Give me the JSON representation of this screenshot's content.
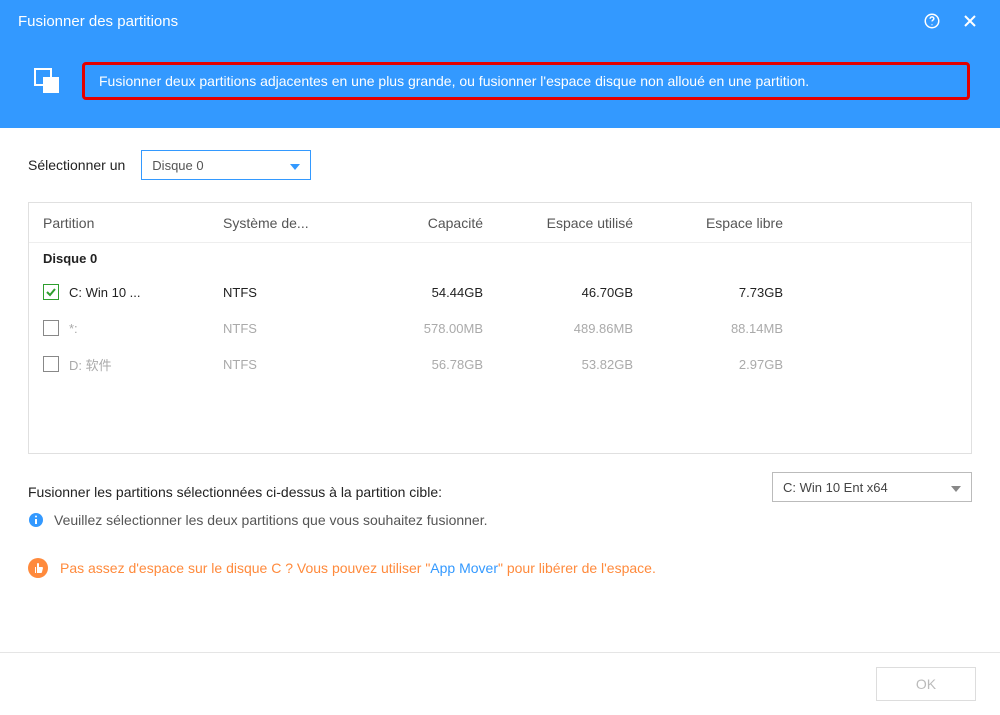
{
  "titlebar": {
    "title": "Fusionner des partitions"
  },
  "banner": {
    "text": "Fusionner deux partitions adjacentes en une plus grande, ou fusionner l'espace disque non alloué en une partition."
  },
  "selector": {
    "label": "Sélectionner un",
    "value": "Disque 0"
  },
  "table": {
    "headers": {
      "partition": "Partition",
      "fs": "Système de...",
      "capacity": "Capacité",
      "used": "Espace utilisé",
      "free": "Espace libre"
    },
    "group": "Disque 0",
    "rows": [
      {
        "checked": true,
        "enabled": true,
        "name": "C: Win 10 ...",
        "fs": "NTFS",
        "capacity": "54.44GB",
        "used": "46.70GB",
        "free": "7.73GB"
      },
      {
        "checked": false,
        "enabled": false,
        "name": "*:",
        "fs": "NTFS",
        "capacity": "578.00MB",
        "used": "489.86MB",
        "free": "88.14MB"
      },
      {
        "checked": false,
        "enabled": false,
        "name": "D: 软件",
        "fs": "NTFS",
        "capacity": "56.78GB",
        "used": "53.82GB",
        "free": "2.97GB"
      }
    ]
  },
  "below": {
    "label": "Fusionner les partitions sélectionnées ci-dessus à la partition cible:",
    "target_value": "C: Win 10 Ent x64"
  },
  "info": {
    "text": "Veuillez sélectionner les deux partitions que vous souhaitez fusionner."
  },
  "warn": {
    "prefix": "Pas assez d'espace sur le disque C ? Vous pouvez utiliser \"",
    "link": "App Mover",
    "suffix": "\" pour libérer de l'espace."
  },
  "footer": {
    "ok": "OK"
  }
}
